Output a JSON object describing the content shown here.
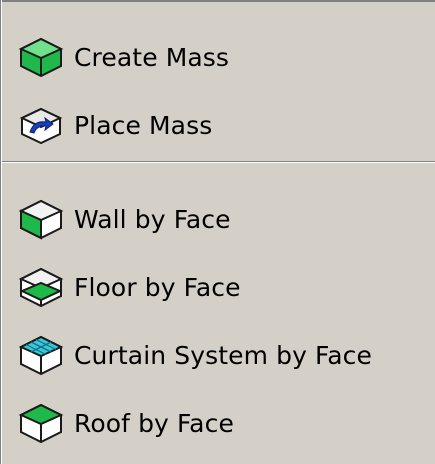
{
  "menu": {
    "items": [
      {
        "label": "Create Mass",
        "icon": "create-mass-icon"
      },
      {
        "label": "Place Mass",
        "icon": "place-mass-icon"
      },
      {
        "label": "Wall by Face",
        "icon": "wall-by-face-icon"
      },
      {
        "label": "Floor by Face",
        "icon": "floor-by-face-icon"
      },
      {
        "label": "Curtain System by Face",
        "icon": "curtain-system-by-face-icon"
      },
      {
        "label": "Roof by Face",
        "icon": "roof-by-face-icon"
      }
    ]
  },
  "colors": {
    "background": "#d4d0c8",
    "mass_green": "#1fb84a",
    "curtain_cyan": "#38c8d8",
    "outline": "#1a1a1a"
  }
}
